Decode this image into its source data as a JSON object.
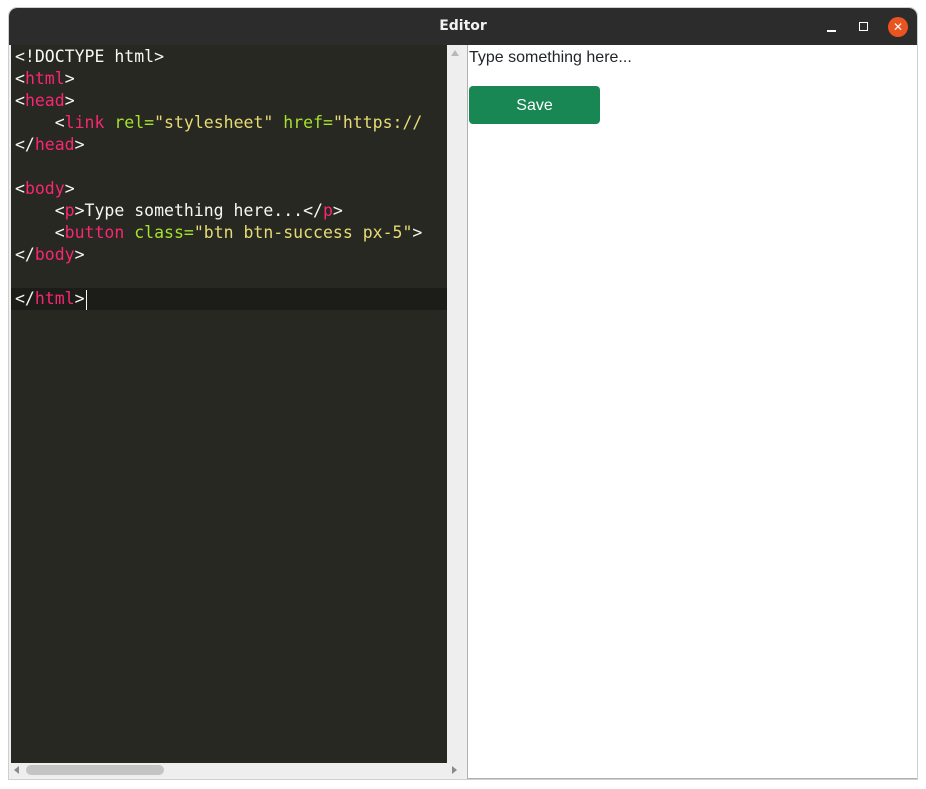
{
  "window": {
    "title": "Editor",
    "minimize_icon": "minimize-icon",
    "maximize_icon": "maximize-icon",
    "close_icon": "close-icon",
    "close_glyph": "✕",
    "close_color": "#e95420"
  },
  "editor": {
    "theme_colors": {
      "background": "#272822",
      "tag": "#f92672",
      "attribute": "#a6e22e",
      "string": "#e6db74",
      "text": "#f8f8f2"
    },
    "lines": [
      [
        {
          "t": "<!DOCTYPE html>",
          "c": "pun"
        }
      ],
      [
        {
          "t": "<",
          "c": "pun"
        },
        {
          "t": "html",
          "c": "tag"
        },
        {
          "t": ">",
          "c": "pun"
        }
      ],
      [
        {
          "t": "<",
          "c": "pun"
        },
        {
          "t": "head",
          "c": "tag"
        },
        {
          "t": ">",
          "c": "pun"
        }
      ],
      [
        {
          "t": "    <",
          "c": "pun"
        },
        {
          "t": "link",
          "c": "tag"
        },
        {
          "t": " ",
          "c": "pun"
        },
        {
          "t": "rel=",
          "c": "attr"
        },
        {
          "t": "\"stylesheet\"",
          "c": "str"
        },
        {
          "t": " ",
          "c": "pun"
        },
        {
          "t": "href=",
          "c": "attr"
        },
        {
          "t": "\"https://",
          "c": "str"
        }
      ],
      [
        {
          "t": "</",
          "c": "pun"
        },
        {
          "t": "head",
          "c": "tag"
        },
        {
          "t": ">",
          "c": "pun"
        }
      ],
      [
        {
          "t": "",
          "c": "pun"
        }
      ],
      [
        {
          "t": "<",
          "c": "pun"
        },
        {
          "t": "body",
          "c": "tag"
        },
        {
          "t": ">",
          "c": "pun"
        }
      ],
      [
        {
          "t": "    <",
          "c": "pun"
        },
        {
          "t": "p",
          "c": "tag"
        },
        {
          "t": ">Type something here...</",
          "c": "pun"
        },
        {
          "t": "p",
          "c": "tag"
        },
        {
          "t": ">",
          "c": "pun"
        }
      ],
      [
        {
          "t": "    <",
          "c": "pun"
        },
        {
          "t": "button",
          "c": "tag"
        },
        {
          "t": " ",
          "c": "pun"
        },
        {
          "t": "class=",
          "c": "attr"
        },
        {
          "t": "\"btn btn-success px-5\"",
          "c": "str"
        },
        {
          "t": ">",
          "c": "pun"
        }
      ],
      [
        {
          "t": "</",
          "c": "pun"
        },
        {
          "t": "body",
          "c": "tag"
        },
        {
          "t": ">",
          "c": "pun"
        }
      ],
      [
        {
          "t": "",
          "c": "pun"
        }
      ],
      [
        {
          "t": "</",
          "c": "pun"
        },
        {
          "t": "html",
          "c": "tag"
        },
        {
          "t": ">",
          "c": "pun"
        }
      ]
    ]
  },
  "preview": {
    "paragraph": "Type something here...",
    "button_label": "Save",
    "button_color": "#198754"
  }
}
